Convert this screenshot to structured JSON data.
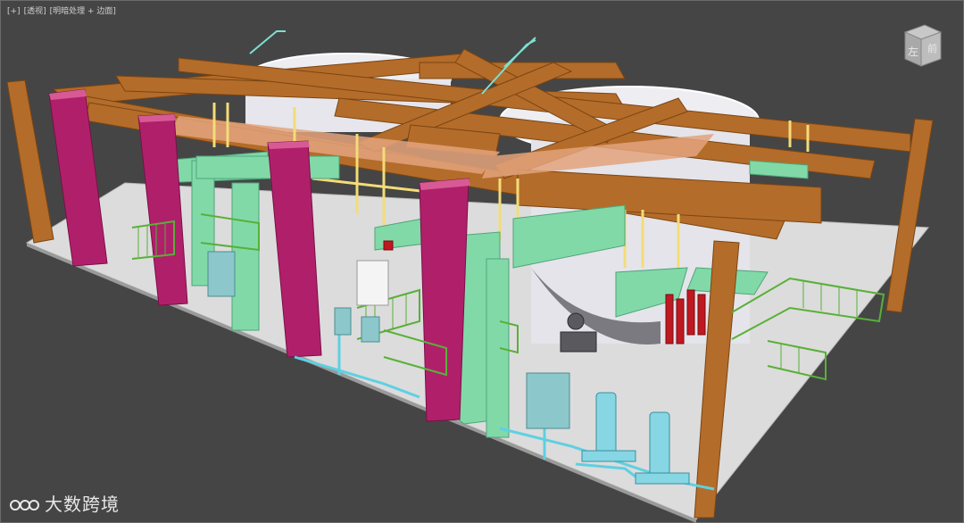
{
  "viewport": {
    "labels": [
      "[+]",
      "[透视]",
      "[明暗处理 + 边面]"
    ]
  },
  "viewcube": {
    "face_label": "左",
    "side_label": "前"
  },
  "watermark": {
    "text": "大数跨境"
  },
  "colors": {
    "background": "#454545",
    "floor": "#d9d9d9",
    "beam": "#b06a28",
    "column": "#b0206a",
    "duct": "#7fd8a8",
    "pipe_yellow": "#f0d870",
    "pipe_cyan": "#5cd0e0",
    "railing": "#4fa030",
    "fire_red": "#c01820",
    "tank": "#e8e8ee"
  }
}
